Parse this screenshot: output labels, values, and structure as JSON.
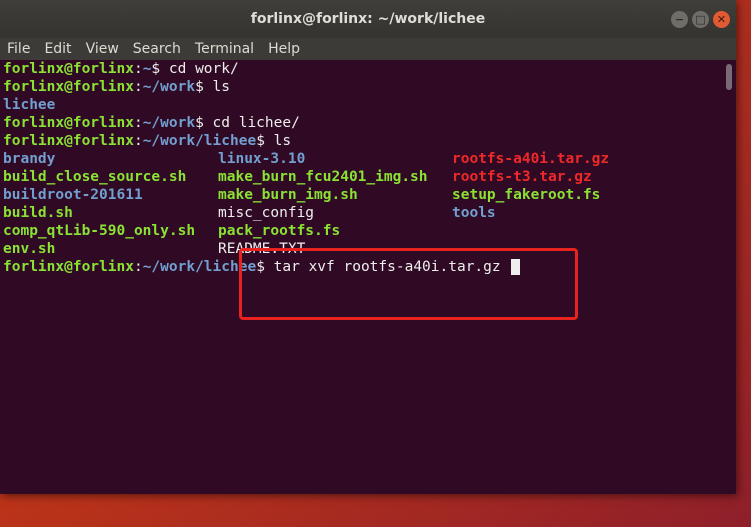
{
  "window": {
    "title": "forlinx@forlinx: ~/work/lichee",
    "controls": [
      "−",
      "□",
      "✕"
    ]
  },
  "menu": [
    "File",
    "Edit",
    "View",
    "Search",
    "Terminal",
    "Help"
  ],
  "prompt": {
    "user_host": "forlinx@forlinx",
    "colon": ":"
  },
  "lines": [
    {
      "path": "~",
      "cmd": "$ cd work/"
    },
    {
      "path": "~/work",
      "cmd": "$ ls"
    },
    {
      "path": "~/work",
      "cmd": "$ cd lichee/"
    },
    {
      "path": "~/work/lichee",
      "cmd": "$ ls"
    },
    {
      "path": "~/work/lichee",
      "cmd": "$ tar xvf rootfs-a40i.tar.gz "
    }
  ],
  "ls_work_output": "lichee",
  "ls_lichee_output": [
    [
      "brandy",
      "linux-3.10",
      "rootfs-a40i.tar.gz"
    ],
    [
      "build_close_source.sh",
      "make_burn_fcu2401_img.sh",
      "rootfs-t3.tar.gz"
    ],
    [
      "buildroot-201611",
      "make_burn_img.sh",
      "setup_fakeroot.fs"
    ],
    [
      "build.sh",
      "misc_config",
      "tools"
    ],
    [
      "comp_qtLib-590_only.sh",
      "pack_rootfs.fs",
      ""
    ],
    [
      "env.sh",
      "README.TXT",
      ""
    ]
  ],
  "colors": {
    "terminal_bg": "#300a24",
    "prompt_green": "#8ae234",
    "dir_blue": "#729fcf",
    "archive_red": "#ef2929",
    "highlight_box": "#e8221e"
  }
}
